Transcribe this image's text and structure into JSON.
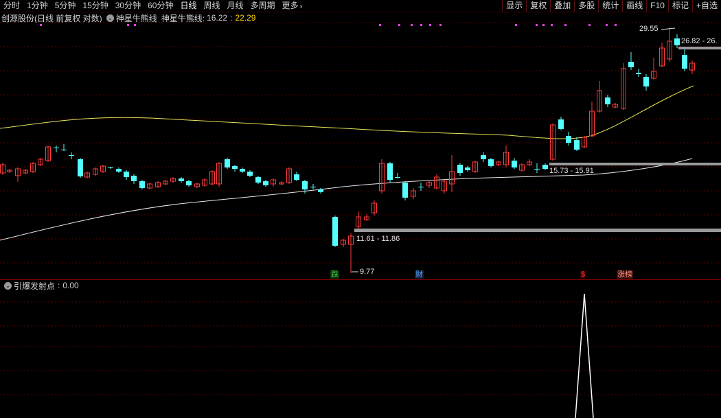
{
  "toolbar": {
    "periods": [
      "分时",
      "1分钟",
      "5分钟",
      "15分钟",
      "30分钟",
      "60分钟",
      "日线",
      "周线",
      "月线",
      "多周期",
      "更多"
    ],
    "active_period": "日线",
    "more_label": "更多",
    "buttons": [
      "显示",
      "复权",
      "叠加",
      "多股",
      "统计",
      "画线",
      "F10",
      "标记",
      "+自选"
    ]
  },
  "header": {
    "stock": "创源股份",
    "mode": "(日线 前复权 对数)",
    "indicator_name": "神星牛熊线",
    "indicator_label": "神星牛熊线:",
    "value1": "16.22",
    "sep": ":",
    "value2": "22.29"
  },
  "price_labels": {
    "high": "29.55",
    "range_top": "26.82 - 26.",
    "range_mid": "15.73 - 15.91",
    "range_low": "11.61 - 11.86",
    "low": "9.77"
  },
  "markers": [
    {
      "text": "跌",
      "color": "#40d040",
      "bg": "#103010"
    },
    {
      "text": "财",
      "color": "#60a8ff",
      "bg": "#10203a"
    },
    {
      "text": "$",
      "color": "#ff3030",
      "bg": "#300000"
    },
    {
      "text": "涨榜",
      "color": "#ff9080",
      "bg": "#3a1010"
    }
  ],
  "sub_indicator": {
    "name": "引爆发射点",
    "sep": ":",
    "value": "0.00"
  },
  "chart_data": {
    "type": "candlestick",
    "series": [
      {
        "name": "神星牛熊线",
        "values": [
          16.22
        ]
      },
      {
        "name": "",
        "values": [
          22.29
        ]
      }
    ],
    "annotations": [
      "29.55",
      "26.82 - 26.",
      "15.73 - 15.91",
      "11.61 - 11.86",
      "9.77"
    ],
    "sub_series": {
      "name": "引爆发射点",
      "values": [
        0.0
      ]
    }
  },
  "colors": {
    "up": "#ff3c3c",
    "down": "#54ffff",
    "ma_yellow": "#e6e65a",
    "ma_white": "#e8e8e8",
    "grid": "#5a0000",
    "band": "#9a9a9a"
  }
}
